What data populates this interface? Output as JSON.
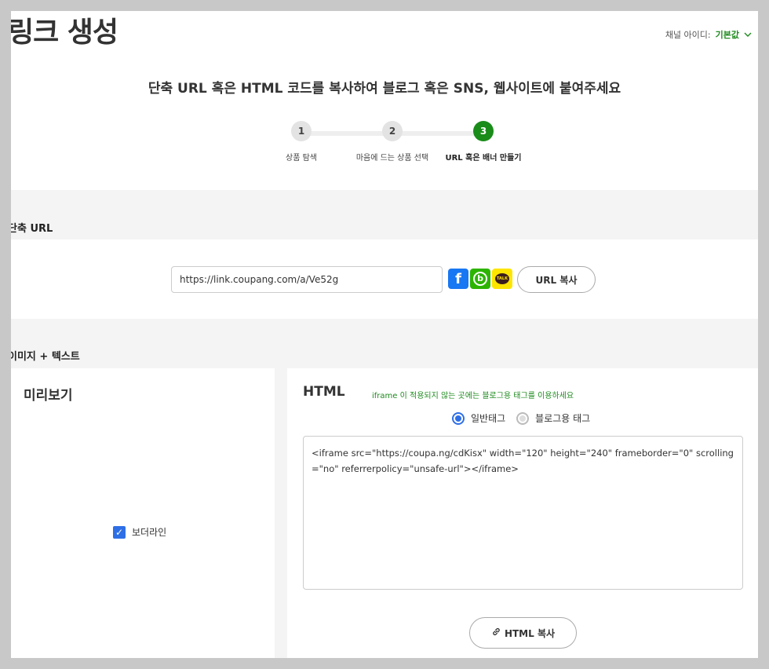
{
  "header": {
    "page_title": "링크 생성",
    "channel_label": "채널 아이디:",
    "channel_value": "기본값",
    "subtitle": "단축 URL 혹은 HTML 코드를 복사하여 블로그 혹은 SNS, 웹사이트에 붙여주세요"
  },
  "steps": [
    {
      "num": "1",
      "label": "상품 탐색"
    },
    {
      "num": "2",
      "label": "마음에 드는 상품 선택"
    },
    {
      "num": "3",
      "label": "URL 혹은 배너 만들기"
    }
  ],
  "short_url": {
    "section_title": "단축 URL",
    "url_value": "https://link.coupang.com/a/Ve52g",
    "copy_button": "URL 복사",
    "sns": {
      "facebook": "f",
      "blog": "b",
      "talk": "TALK"
    }
  },
  "image_text": {
    "section_title": "이미지 + 텍스트",
    "preview_title": "미리보기",
    "border_checkbox_label": "보더라인",
    "html_title": "HTML",
    "hint": "iframe 이 적용되지 않는 곳에는 블로그용 태그를 이용하세요",
    "radio_normal": "일반태그",
    "radio_blog": "블로그용 태그",
    "code": "<iframe src=\"https://coupa.ng/cdKisx\" width=\"120\" height=\"240\" frameborder=\"0\" scrolling=\"no\" referrerpolicy=\"unsafe-url\"></iframe>",
    "copy_button": "HTML 복사"
  },
  "colors": {
    "accent_green": "#1a8c1a",
    "blue": "#2e6fe6"
  }
}
